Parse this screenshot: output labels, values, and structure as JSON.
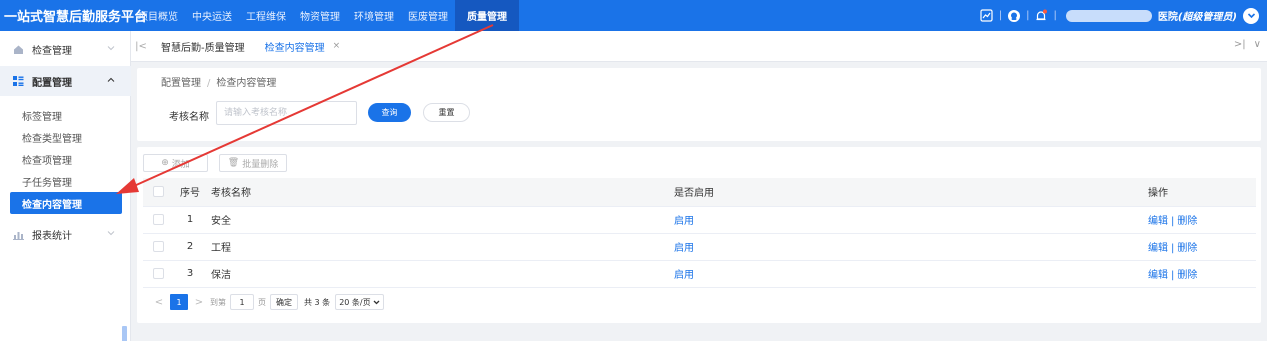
{
  "app": {
    "title": "一站式智慧后勤服务平台"
  },
  "topnav": [
    {
      "label": "项目概览"
    },
    {
      "label": "中央运送"
    },
    {
      "label": "工程维保"
    },
    {
      "label": "物资管理"
    },
    {
      "label": "环境管理"
    },
    {
      "label": "医废管理"
    },
    {
      "label": "质量管理",
      "active": true
    }
  ],
  "topright": {
    "icons": [
      "chart-icon",
      "headset-icon",
      "bell-icon"
    ],
    "user_suffix": "医院",
    "user_role": "(超级管理员)"
  },
  "sidebar": {
    "groups": [
      {
        "label": "检查管理",
        "icon": "home-icon",
        "open": false
      },
      {
        "label": "配置管理",
        "icon": "grid-icon",
        "open": true
      },
      {
        "label": "报表统计",
        "icon": "bar-chart-icon",
        "open": false
      }
    ],
    "items": [
      {
        "label": "标签管理"
      },
      {
        "label": "检查类型管理"
      },
      {
        "label": "检查项管理"
      },
      {
        "label": "子任务管理"
      },
      {
        "label": "检查内容管理",
        "active": true
      }
    ]
  },
  "tabs": [
    {
      "label": "智慧后勤-质量管理"
    },
    {
      "label": "检查内容管理",
      "active": true,
      "close": "×"
    }
  ],
  "tabs_right": {
    "next": ">|",
    "expand": "∨"
  },
  "breadcrumb": [
    "配置管理",
    "检查内容管理"
  ],
  "breadcrumb_sep": "/",
  "search": {
    "label": "考核名称",
    "placeholder": "请输入考核名称",
    "query_label": "查询",
    "reset_label": "重置"
  },
  "toolbar": {
    "add_label": "添加",
    "batch_delete_label": "批量删除"
  },
  "table": {
    "headers": {
      "index": "序号",
      "name": "考核名称",
      "enabled": "是否启用",
      "actions": "操作"
    },
    "rows": [
      {
        "index": "1",
        "name": "安全",
        "enabled": "启用",
        "edit": "编辑",
        "delete": "删除"
      },
      {
        "index": "2",
        "name": "工程",
        "enabled": "启用",
        "edit": "编辑",
        "delete": "删除"
      },
      {
        "index": "3",
        "name": "保洁",
        "enabled": "启用",
        "edit": "编辑",
        "delete": "删除"
      }
    ],
    "ops_sep": "|"
  },
  "pagination": {
    "current": "1",
    "goto_prefix": "到第",
    "goto_value": "1",
    "goto_suffix": "页",
    "confirm": "确定",
    "total": "共 3 条",
    "page_size": "20 条/页"
  },
  "colors": {
    "primary": "#1a73e8",
    "annotation": "#e53935"
  }
}
